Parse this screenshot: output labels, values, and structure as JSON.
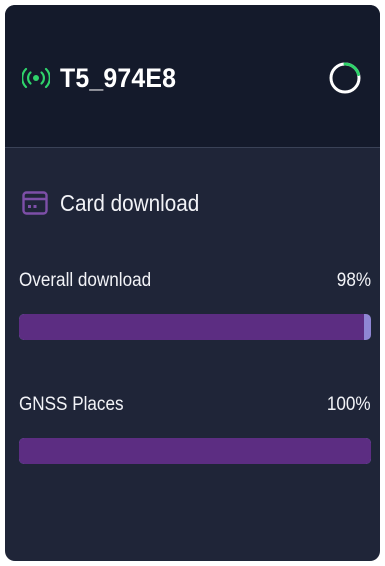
{
  "device": {
    "name": "T5_974E8",
    "status_icon": "wifi-signal-icon",
    "loading_icon": "spinner-icon"
  },
  "card_download": {
    "title": "Card download",
    "icon": "sd-card-icon",
    "items": [
      {
        "label": "Overall download",
        "value_text": "98%",
        "progress": 0.98
      },
      {
        "label": "GNSS Places",
        "value_text": "100%",
        "progress": 1.0
      }
    ]
  },
  "colors": {
    "header_bg": "#141a2b",
    "body_bg": "#1f2538",
    "signal": "#2fd36b",
    "accent_purple": "#7d4fa7",
    "bar_fill": "#5c2d82",
    "bar_track": "#8f86d4"
  }
}
